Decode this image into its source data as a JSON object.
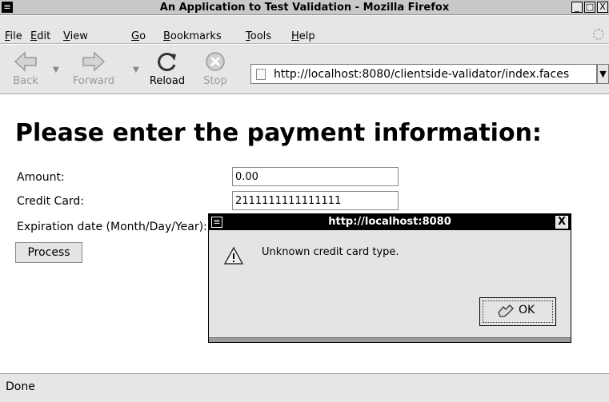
{
  "window": {
    "title": "An Application to Test Validation - Mozilla Firefox",
    "controls": {
      "minimize": "_",
      "maximize": "□",
      "close": "X"
    }
  },
  "menubar": {
    "items": [
      {
        "underlined": "F",
        "rest": "ile"
      },
      {
        "underlined": "E",
        "rest": "dit"
      },
      {
        "underlined": "V",
        "rest": "iew"
      },
      {
        "underlined": "G",
        "rest": "o"
      },
      {
        "underlined": "B",
        "rest": "ookmarks"
      },
      {
        "underlined": "T",
        "rest": "ools"
      },
      {
        "underlined": "H",
        "rest": "elp"
      }
    ]
  },
  "navbar": {
    "back": {
      "label": "Back",
      "icon": "back-arrow-icon",
      "enabled": false
    },
    "forward": {
      "label": "Forward",
      "icon": "forward-arrow-icon",
      "enabled": false
    },
    "reload": {
      "label": "Reload",
      "icon": "reload-icon",
      "enabled": true
    },
    "stop": {
      "label": "Stop",
      "icon": "stop-icon",
      "enabled": false
    },
    "url": "http://localhost:8080/clientside-validator/index.faces"
  },
  "page": {
    "heading": "Please enter the payment information:",
    "fields": [
      {
        "label": "Amount:",
        "value": "0.00"
      },
      {
        "label": "Credit Card:",
        "value": "2111111111111111"
      },
      {
        "label": "Expiration date (Month/Day/Year):",
        "value": ""
      }
    ],
    "process_label": "Process"
  },
  "dialog": {
    "title": "http://localhost:8080",
    "message": "Unknown credit card type.",
    "icon": "warning-icon",
    "ok_label": "OK",
    "close": "X"
  },
  "status": {
    "text": "Done"
  },
  "colors": {
    "chrome": "#e6e6e6",
    "dialog_title": "#000000",
    "page_bg": "#ffffff"
  }
}
